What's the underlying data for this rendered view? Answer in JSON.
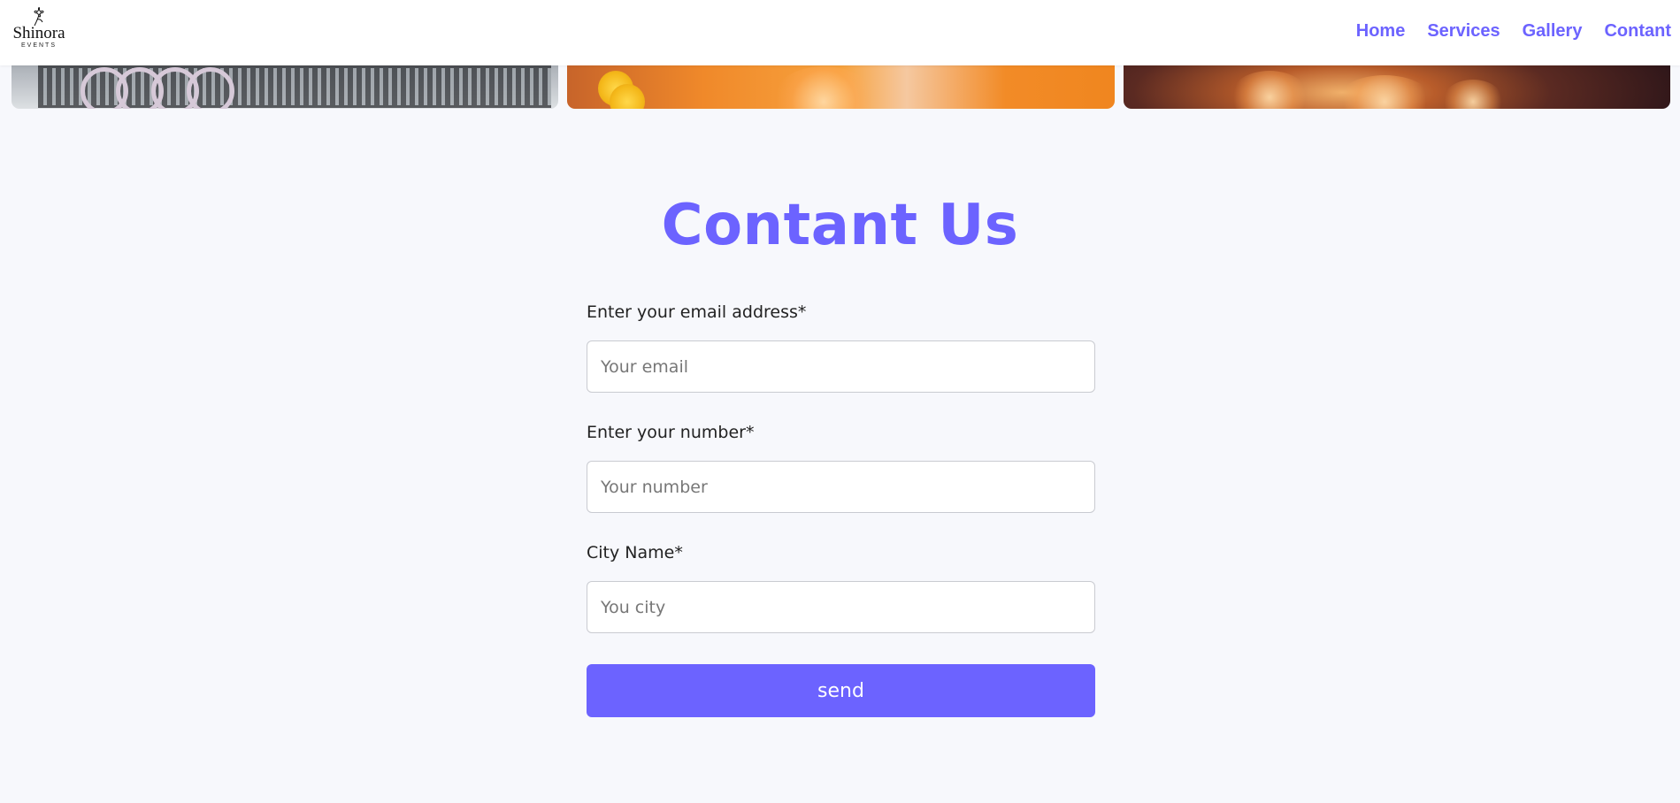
{
  "brand": {
    "name": "Shinora",
    "tagline": "EVENTS"
  },
  "nav": {
    "items": [
      {
        "label": "Home"
      },
      {
        "label": "Services"
      },
      {
        "label": "Gallery"
      },
      {
        "label": "Contant"
      }
    ]
  },
  "gallery": {
    "images": [
      {
        "icon": "car-grille-image"
      },
      {
        "icon": "decor-flowers-image"
      },
      {
        "icon": "bokeh-lights-image"
      }
    ]
  },
  "contact": {
    "title": "Contant Us",
    "email": {
      "label": "Enter your email address*",
      "placeholder": "Your email",
      "value": ""
    },
    "number": {
      "label": "Enter your number*",
      "placeholder": "Your number",
      "value": ""
    },
    "city": {
      "label": "City Name*",
      "placeholder": "You city",
      "value": ""
    },
    "submit_label": "send"
  },
  "colors": {
    "accent": "#6c63ff",
    "background": "#f7f8fc",
    "navbar": "#ffffff"
  }
}
